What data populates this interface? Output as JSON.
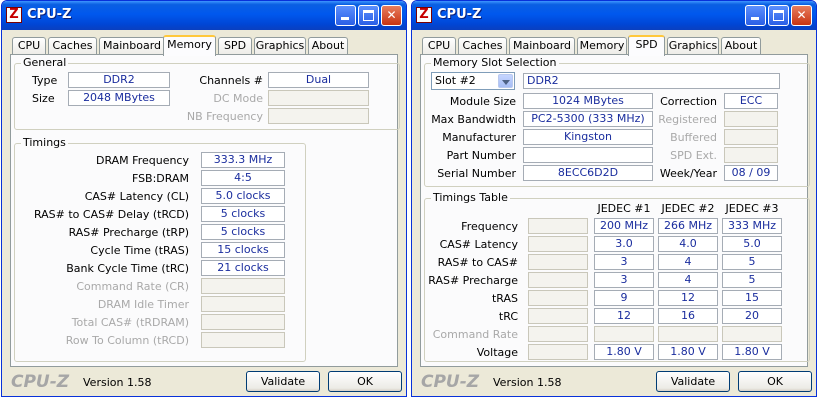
{
  "window1": {
    "title": "CPU-Z",
    "tabs": [
      "CPU",
      "Caches",
      "Mainboard",
      "Memory",
      "SPD",
      "Graphics",
      "About"
    ],
    "active_tab": "Memory",
    "general": {
      "legend": "General",
      "type_label": "Type",
      "type_value": "DDR2",
      "size_label": "Size",
      "size_value": "2048 MBytes",
      "channels_label": "Channels #",
      "channels_value": "Dual",
      "dcmode_label": "DC Mode",
      "dcmode_value": "",
      "nbfreq_label": "NB Frequency",
      "nbfreq_value": ""
    },
    "timings": {
      "legend": "Timings",
      "rows": [
        {
          "label": "DRAM Frequency",
          "value": "333.3 MHz",
          "enabled": true
        },
        {
          "label": "FSB:DRAM",
          "value": "4:5",
          "enabled": true
        },
        {
          "label": "CAS# Latency (CL)",
          "value": "5.0 clocks",
          "enabled": true
        },
        {
          "label": "RAS# to CAS# Delay (tRCD)",
          "value": "5 clocks",
          "enabled": true
        },
        {
          "label": "RAS# Precharge (tRP)",
          "value": "5 clocks",
          "enabled": true
        },
        {
          "label": "Cycle Time (tRAS)",
          "value": "15 clocks",
          "enabled": true
        },
        {
          "label": "Bank Cycle Time (tRC)",
          "value": "21 clocks",
          "enabled": true
        },
        {
          "label": "Command Rate (CR)",
          "value": "",
          "enabled": false
        },
        {
          "label": "DRAM Idle Timer",
          "value": "",
          "enabled": false
        },
        {
          "label": "Total CAS# (tRDRAM)",
          "value": "",
          "enabled": false
        },
        {
          "label": "Row To Column (tRCD)",
          "value": "",
          "enabled": false
        }
      ]
    },
    "logo": "CPU-Z",
    "version": "Version 1.58",
    "validate_label": "Validate",
    "ok_label": "OK"
  },
  "window2": {
    "title": "CPU-Z",
    "tabs": [
      "CPU",
      "Caches",
      "Mainboard",
      "Memory",
      "SPD",
      "Graphics",
      "About"
    ],
    "active_tab": "SPD",
    "slot": {
      "legend": "Memory Slot Selection",
      "selected": "Slot #2",
      "type_value": "DDR2",
      "module_size_label": "Module Size",
      "module_size_value": "1024 MBytes",
      "max_bw_label": "Max Bandwidth",
      "max_bw_value": "PC2-5300 (333 MHz)",
      "manufacturer_label": "Manufacturer",
      "manufacturer_value": "Kingston",
      "part_label": "Part Number",
      "part_value": "",
      "serial_label": "Serial Number",
      "serial_value": "8ECC6D2D",
      "correction_label": "Correction",
      "correction_value": "ECC",
      "registered_label": "Registered",
      "registered_value": "",
      "buffered_label": "Buffered",
      "buffered_value": "",
      "spdext_label": "SPD Ext.",
      "spdext_value": "",
      "weekyear_label": "Week/Year",
      "weekyear_value": "08 / 09"
    },
    "timings_table": {
      "legend": "Timings Table",
      "columns": [
        "JEDEC #1",
        "JEDEC #2",
        "JEDEC #3"
      ],
      "rows": [
        {
          "label": "Frequency",
          "values": [
            "200 MHz",
            "266 MHz",
            "333 MHz"
          ],
          "enabled": true
        },
        {
          "label": "CAS# Latency",
          "values": [
            "3.0",
            "4.0",
            "5.0"
          ],
          "enabled": true
        },
        {
          "label": "RAS# to CAS#",
          "values": [
            "3",
            "4",
            "5"
          ],
          "enabled": true
        },
        {
          "label": "RAS# Precharge",
          "values": [
            "3",
            "4",
            "5"
          ],
          "enabled": true
        },
        {
          "label": "tRAS",
          "values": [
            "9",
            "12",
            "15"
          ],
          "enabled": true
        },
        {
          "label": "tRC",
          "values": [
            "12",
            "16",
            "20"
          ],
          "enabled": true
        },
        {
          "label": "Command Rate",
          "values": [
            "",
            "",
            ""
          ],
          "enabled": false
        },
        {
          "label": "Voltage",
          "values": [
            "1.80 V",
            "1.80 V",
            "1.80 V"
          ],
          "enabled": true
        }
      ]
    },
    "logo": "CPU-Z",
    "version": "Version 1.58",
    "validate_label": "Validate",
    "ok_label": "OK"
  }
}
